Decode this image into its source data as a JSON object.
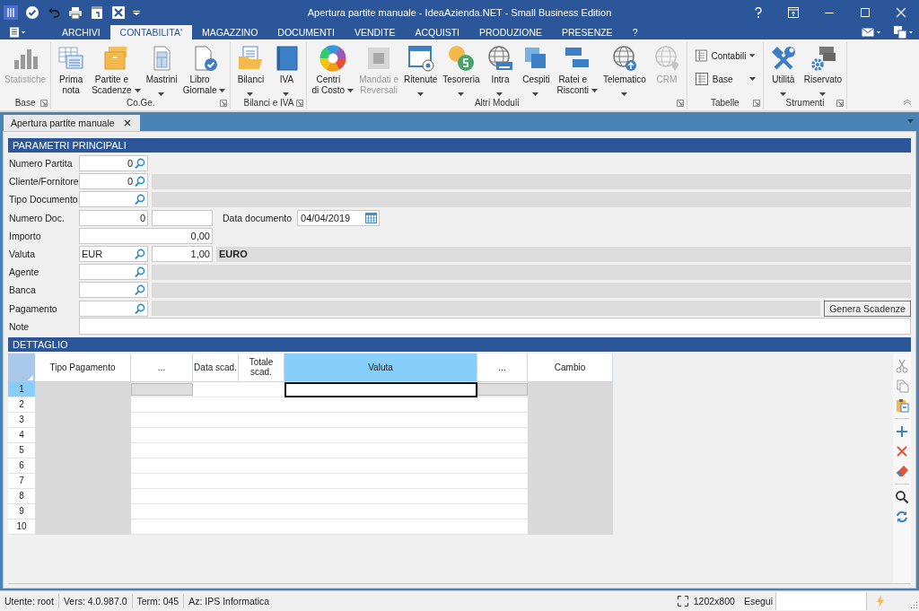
{
  "window": {
    "title": "Apertura partite manuale - IdeaAzienda.NET - Small Business Edition"
  },
  "menu_tabs": [
    {
      "label": "ARCHIVI",
      "selected": false
    },
    {
      "label": "CONTABILITA'",
      "selected": true
    },
    {
      "label": "MAGAZZINO",
      "selected": false
    },
    {
      "label": "DOCUMENTI",
      "selected": false
    },
    {
      "label": "VENDITE",
      "selected": false
    },
    {
      "label": "ACQUISTI",
      "selected": false
    },
    {
      "label": "PRODUZIONE",
      "selected": false
    },
    {
      "label": "PRESENZE",
      "selected": false
    },
    {
      "label": "?",
      "selected": false
    }
  ],
  "ribbon_groups": [
    {
      "label": "Base",
      "launcher": true,
      "buttons": [
        {
          "kind": "large",
          "label": "Statistiche",
          "dropdown": false,
          "disabled": true
        }
      ]
    },
    {
      "label": "Co.Ge.",
      "launcher": true,
      "buttons": [
        {
          "kind": "large",
          "label": "Prima\nnota",
          "dropdown": false,
          "disabled": false
        },
        {
          "kind": "large",
          "label": "Partite e\nScadenze",
          "dropdown": true,
          "disabled": false
        },
        {
          "kind": "large",
          "label": "Mastrini",
          "dropdown": true,
          "disabled": false
        },
        {
          "kind": "large",
          "label": "Libro\nGiornale",
          "dropdown": true,
          "disabled": false
        }
      ]
    },
    {
      "label": "Bilanci e IVA",
      "launcher": true,
      "buttons": [
        {
          "kind": "large",
          "label": "Bilanci",
          "dropdown": true,
          "disabled": false
        },
        {
          "kind": "large",
          "label": "IVA",
          "dropdown": true,
          "disabled": false
        }
      ]
    },
    {
      "label": "Altri Moduli",
      "launcher": true,
      "buttons": [
        {
          "kind": "large",
          "label": "Centri\ndi Costo",
          "dropdown": true,
          "disabled": false
        },
        {
          "kind": "large",
          "label": "Mandati e\nReversali",
          "dropdown": false,
          "disabled": true
        },
        {
          "kind": "large",
          "label": "Ritenute",
          "dropdown": true,
          "disabled": false
        },
        {
          "kind": "large",
          "label": "Tesoreria",
          "dropdown": true,
          "disabled": false
        },
        {
          "kind": "large",
          "label": "Intra",
          "dropdown": true,
          "disabled": false
        },
        {
          "kind": "large",
          "label": "Cespiti",
          "dropdown": true,
          "disabled": false
        },
        {
          "kind": "large",
          "label": "Ratei e\nRisconti",
          "dropdown": true,
          "disabled": false
        },
        {
          "kind": "large",
          "label": "Telematico",
          "dropdown": true,
          "disabled": false
        },
        {
          "kind": "large",
          "label": "CRM",
          "dropdown": false,
          "disabled": true
        }
      ]
    },
    {
      "label": "Tabelle",
      "launcher": true,
      "buttons": [
        {
          "kind": "small",
          "label": "Contabili",
          "dropdown": true,
          "disabled": false
        },
        {
          "kind": "small",
          "label": "Base",
          "dropdown": true,
          "disabled": false
        }
      ]
    },
    {
      "label": "Strumenti",
      "launcher": true,
      "buttons": [
        {
          "kind": "large",
          "label": "Utilità",
          "dropdown": true,
          "disabled": false
        },
        {
          "kind": "large",
          "label": "Riservato",
          "dropdown": true,
          "disabled": false
        }
      ]
    }
  ],
  "doc_tabs": [
    {
      "label": "Apertura partite manuale",
      "selected": true
    }
  ],
  "main_section": {
    "title": "PARAMETRI PRINCIPALI",
    "rows": [
      {
        "label": "Numero Partita",
        "items": [
          {
            "kind": "lookup",
            "value": "0",
            "numeric": true
          }
        ]
      },
      {
        "label": "Cliente/Fornitore",
        "items": [
          {
            "kind": "lookup",
            "value": "0",
            "numeric": true
          },
          {
            "kind": "description"
          }
        ]
      },
      {
        "label": "Tipo Documento",
        "items": [
          {
            "kind": "lookup"
          },
          {
            "kind": "description"
          }
        ]
      },
      {
        "label": "Numero Doc.",
        "items": [
          {
            "kind": "number",
            "value": "0"
          },
          {
            "kind": "text"
          },
          {
            "kind": "caption",
            "value": "Data documento"
          },
          {
            "kind": "date",
            "value": "04/04/2019"
          }
        ]
      },
      {
        "label": "Importo",
        "items": [
          {
            "kind": "amount",
            "value": "0,00"
          }
        ]
      },
      {
        "label": "Valuta",
        "items": [
          {
            "kind": "lookup",
            "value": "EUR",
            "numeric": false
          },
          {
            "kind": "number",
            "value": "1,00"
          },
          {
            "kind": "description",
            "value": "EURO"
          }
        ]
      },
      {
        "label": "Agente",
        "items": [
          {
            "kind": "lookup"
          },
          {
            "kind": "description"
          }
        ]
      },
      {
        "label": "Banca",
        "items": [
          {
            "kind": "lookup"
          },
          {
            "kind": "description"
          }
        ]
      },
      {
        "label": "Pagamento",
        "items": [
          {
            "kind": "lookup"
          },
          {
            "kind": "description"
          },
          {
            "kind": "button",
            "value": "Genera Scadenze"
          }
        ]
      },
      {
        "label": "Note",
        "items": [
          {
            "kind": "memo"
          }
        ]
      }
    ]
  },
  "detail_section": {
    "title": "DETTAGLIO",
    "columns": [
      {
        "label": "Tipo Pagamento",
        "kind": "text",
        "readonly": true,
        "selected": false
      },
      {
        "label": "...",
        "kind": "ellipsis",
        "readonly": false,
        "selected": false
      },
      {
        "label": "Data scad.",
        "kind": "text",
        "readonly": false,
        "selected": false
      },
      {
        "label": "Totale\nscad.",
        "kind": "text",
        "readonly": false,
        "selected": false
      },
      {
        "label": "Valuta",
        "kind": "text",
        "readonly": false,
        "selected": true
      },
      {
        "label": "...",
        "kind": "ellipsis",
        "readonly": false,
        "selected": false
      },
      {
        "label": "Cambio",
        "kind": "text",
        "readonly": true,
        "selected": false
      }
    ],
    "rows": [
      {
        "number": "1",
        "selected": true
      },
      {
        "number": "2",
        "selected": false
      },
      {
        "number": "3",
        "selected": false
      },
      {
        "number": "4",
        "selected": false
      },
      {
        "number": "5",
        "selected": false
      },
      {
        "number": "6",
        "selected": false
      },
      {
        "number": "7",
        "selected": false
      },
      {
        "number": "8",
        "selected": false
      },
      {
        "number": "9",
        "selected": false
      },
      {
        "number": "10",
        "selected": false
      }
    ],
    "tool_groups": [
      {
        "tools": [
          {
            "kind": "cut",
            "disabled": true
          },
          {
            "kind": "copy",
            "disabled": true
          },
          {
            "kind": "paste",
            "disabled": false
          }
        ]
      },
      {
        "tools": [
          {
            "kind": "add",
            "disabled": false
          },
          {
            "kind": "delete",
            "disabled": false
          },
          {
            "kind": "erase",
            "disabled": false
          }
        ]
      },
      {
        "tools": [
          {
            "kind": "search",
            "disabled": false
          },
          {
            "kind": "refresh",
            "disabled": false
          }
        ]
      }
    ]
  },
  "status_bar": {
    "user": "Utente: root",
    "version": "Vers: 4.0.987.0",
    "terminal": "Term: 045",
    "company": "Az: IPS Informatica",
    "resolution": "1202x800",
    "run_label": "Esegui"
  }
}
